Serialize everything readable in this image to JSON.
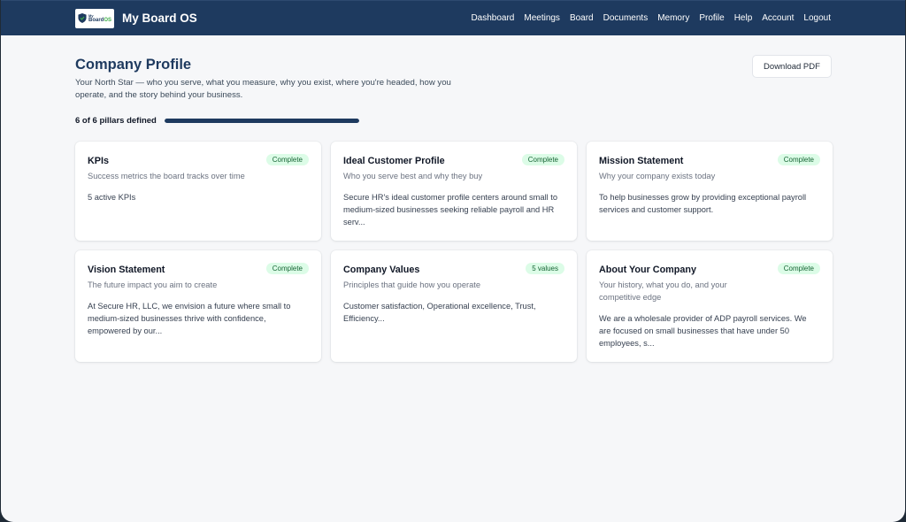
{
  "nav": {
    "logo_small": "My",
    "logo_big_a": "Board",
    "logo_big_b": "OS",
    "brand": "My Board OS",
    "links": [
      "Dashboard",
      "Meetings",
      "Board",
      "Documents",
      "Memory",
      "Profile",
      "Help",
      "Account",
      "Logout"
    ]
  },
  "header": {
    "title": "Company Profile",
    "subtitle": "Your North Star — who you serve, what you measure, why you exist, where you're headed, how you operate, and the story behind your business.",
    "download_label": "Download PDF"
  },
  "progress": {
    "label": "6 of 6 pillars defined",
    "defined": 6,
    "total": 6
  },
  "colors": {
    "brand": "#1e3a5f",
    "badge_bg": "#dcfce7",
    "badge_text": "#166534"
  },
  "cards": [
    {
      "title": "KPIs",
      "subtitle": "Success metrics the board tracks over time",
      "body": "5 active KPIs",
      "badge": "Complete"
    },
    {
      "title": "Ideal Customer Profile",
      "subtitle": "Who you serve best and why they buy",
      "body": "Secure HR's ideal customer profile centers around small to medium-sized businesses seeking reliable payroll and HR serv...",
      "badge": "Complete"
    },
    {
      "title": "Mission Statement",
      "subtitle": "Why your company exists today",
      "body": "To help businesses grow by providing exceptional payroll services and customer support.",
      "badge": "Complete"
    },
    {
      "title": "Vision Statement",
      "subtitle": "The future impact you aim to create",
      "body": "At Secure HR, LLC, we envision a future where small to medium-sized businesses thrive with confidence, empowered by our...",
      "badge": "Complete"
    },
    {
      "title": "Company Values",
      "subtitle": "Principles that guide how you operate",
      "body": "Customer satisfaction, Operational excellence, Trust, Efficiency...",
      "badge": "5 values"
    },
    {
      "title": "About Your Company",
      "subtitle": "Your history, what you do, and your competitive edge",
      "body": "We are a wholesale provider of ADP payroll services. We are focused on small businesses that have under 50 employees, s...",
      "badge": "Complete"
    }
  ]
}
